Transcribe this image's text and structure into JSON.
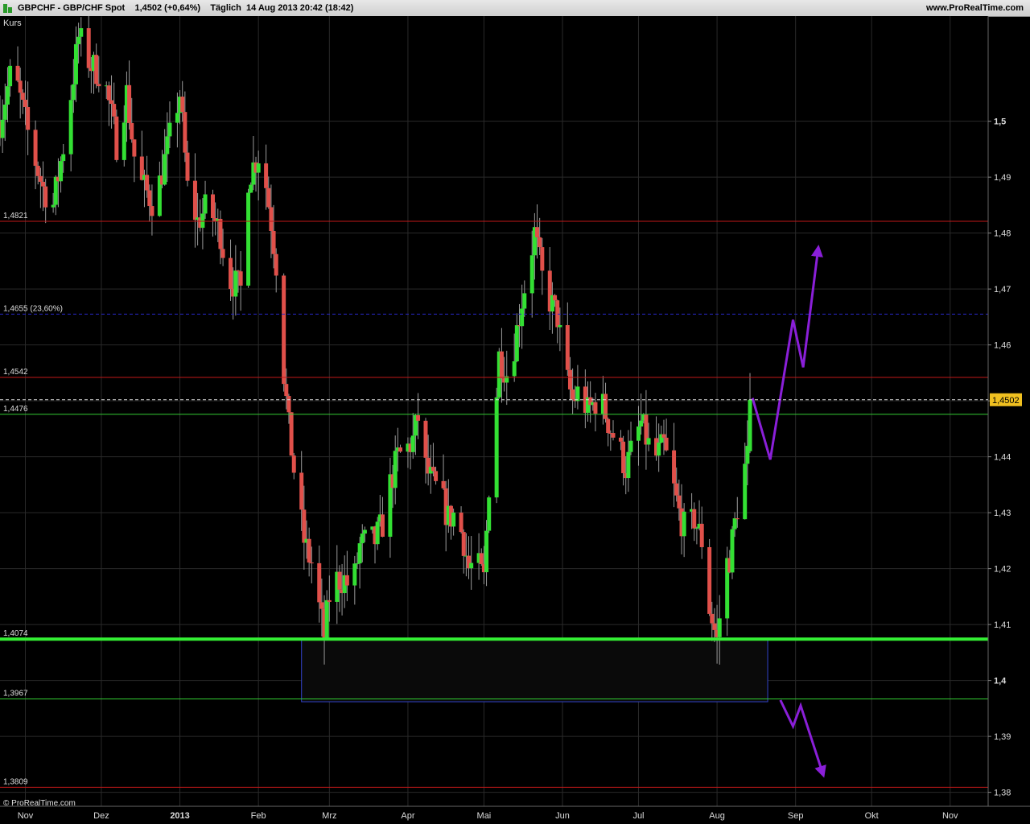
{
  "header": {
    "symbol": "GBPCHF - GBP/CHF Spot",
    "price_change": "1,4502 (+0,64%)",
    "info": "Täglich  14 Aug 2013 20:42 (18:42)",
    "site": "www.ProRealTime.com"
  },
  "watermark": "© ProRealTime.com",
  "colors": {
    "up": "#33e033",
    "down": "#e0504a",
    "background": "#000000",
    "grid": "#2a2a2a",
    "arrows": "#8a1fd8",
    "price_tag": "#f0c020"
  },
  "chart_data": {
    "type": "candlestick",
    "title": "",
    "ylabel": "Kurs",
    "xlabel": "",
    "ylim": [
      1.3775,
      1.5188
    ],
    "y_ticks": [
      "1,5",
      "1,49",
      "1,48",
      "1,47",
      "1,46",
      "1,45",
      "1,44",
      "1,43",
      "1,42",
      "1,41",
      "1,4",
      "1,39",
      "1,38"
    ],
    "y_tick_values": [
      1.5,
      1.49,
      1.48,
      1.47,
      1.46,
      1.45,
      1.44,
      1.43,
      1.42,
      1.41,
      1.4,
      1.39,
      1.38
    ],
    "x_ticks": [
      "Nov",
      "Dez",
      "2013",
      "Feb",
      "Mrz",
      "Apr",
      "Mai",
      "Jun",
      "Jul",
      "Aug",
      "Sep",
      "Okt",
      "Nov"
    ],
    "x_tick_dates": [
      "2012-11-01",
      "2012-12-01",
      "2013-01-01",
      "2013-02-01",
      "2013-03-01",
      "2013-04-01",
      "2013-05-01",
      "2013-06-01",
      "2013-07-01",
      "2013-08-01",
      "2013-09-01",
      "2013-10-01",
      "2013-11-01"
    ],
    "x_tick_bold": [
      false,
      false,
      true,
      false,
      false,
      false,
      false,
      false,
      false,
      false,
      false,
      false,
      false
    ],
    "current_price": {
      "value": 1.4502,
      "label": "1,4502"
    },
    "levels": [
      {
        "value": 1.4821,
        "label": "1,4821",
        "color": "#c01818",
        "style": "solid",
        "width": 1
      },
      {
        "value": 1.4655,
        "label": "1,4655 (23,60%)",
        "color": "#2828c8",
        "style": "dashed",
        "width": 1
      },
      {
        "value": 1.4542,
        "label": "1,4542",
        "color": "#c01818",
        "style": "solid",
        "width": 1
      },
      {
        "value": 1.4476,
        "label": "1,4476",
        "color": "#33cc33",
        "style": "solid",
        "width": 1
      },
      {
        "value": 1.4074,
        "label": "1,4074",
        "color": "#33ee33",
        "style": "solid",
        "width": 4
      },
      {
        "value": 1.3967,
        "label": "1,3967",
        "color": "#33cc33",
        "style": "solid",
        "width": 1
      },
      {
        "value": 1.3809,
        "label": "1,3809",
        "color": "#c01818",
        "style": "solid",
        "width": 1
      }
    ],
    "zone": {
      "date_start": "2013-02-18",
      "date_end": "2013-08-21",
      "y_low": 1.3962,
      "y_high": 1.4074
    },
    "projections": {
      "up": [
        [
          "2013-08-15",
          1.4505
        ],
        [
          "2013-08-22",
          1.4395
        ],
        [
          "2013-08-31",
          1.4645
        ],
        [
          "2013-09-04",
          1.456
        ],
        [
          "2013-09-10",
          1.4775
        ]
      ],
      "down": [
        [
          "2013-08-26",
          1.3965
        ],
        [
          "2013-08-31",
          1.3918
        ],
        [
          "2013-09-03",
          1.3955
        ],
        [
          "2013-09-12",
          1.383
        ]
      ]
    },
    "closes": [
      [
        "2012-10-22",
        1.5
      ],
      [
        "2012-10-27",
        1.51
      ],
      [
        "2012-11-03",
        1.496
      ],
      [
        "2012-11-08",
        1.488
      ],
      [
        "2012-11-12",
        1.485
      ],
      [
        "2012-11-17",
        1.498
      ],
      [
        "2012-11-22",
        1.515
      ],
      [
        "2012-11-27",
        1.51
      ],
      [
        "2012-12-02",
        1.508
      ],
      [
        "2012-12-07",
        1.496
      ],
      [
        "2012-12-11",
        1.505
      ],
      [
        "2012-12-15",
        1.49
      ],
      [
        "2012-12-18",
        1.488
      ],
      [
        "2012-12-22",
        1.485
      ],
      [
        "2012-12-27",
        1.495
      ],
      [
        "2013-01-01",
        1.505
      ],
      [
        "2013-01-04",
        1.488
      ],
      [
        "2013-01-08",
        1.482
      ],
      [
        "2013-01-12",
        1.485
      ],
      [
        "2013-01-17",
        1.48
      ],
      [
        "2013-01-20",
        1.472
      ],
      [
        "2013-01-25",
        1.47
      ],
      [
        "2013-01-28",
        1.49
      ],
      [
        "2013-02-02",
        1.495
      ],
      [
        "2013-02-06",
        1.482
      ],
      [
        "2013-02-09",
        1.471
      ],
      [
        "2013-02-11",
        1.455
      ],
      [
        "2013-02-13",
        1.445
      ],
      [
        "2013-02-16",
        1.434
      ],
      [
        "2013-02-19",
        1.425
      ],
      [
        "2013-02-21",
        1.422
      ],
      [
        "2013-02-23",
        1.42
      ],
      [
        "2013-02-25",
        1.413
      ],
      [
        "2013-02-27",
        1.408
      ],
      [
        "2013-03-01",
        1.415
      ],
      [
        "2013-03-04",
        1.418
      ],
      [
        "2013-03-07",
        1.418
      ],
      [
        "2013-03-10",
        1.416
      ],
      [
        "2013-03-13",
        1.424
      ],
      [
        "2013-03-16",
        1.425
      ],
      [
        "2013-03-19",
        1.425
      ],
      [
        "2013-03-22",
        1.428
      ],
      [
        "2013-03-25",
        1.435
      ],
      [
        "2013-03-28",
        1.44
      ],
      [
        "2013-03-31",
        1.441
      ],
      [
        "2013-04-03",
        1.443
      ],
      [
        "2013-04-05",
        1.447
      ],
      [
        "2013-04-08",
        1.438
      ],
      [
        "2013-04-11",
        1.435
      ],
      [
        "2013-04-14",
        1.433
      ],
      [
        "2013-04-17",
        1.429
      ],
      [
        "2013-04-20",
        1.43
      ],
      [
        "2013-04-23",
        1.425
      ],
      [
        "2013-04-25",
        1.42
      ],
      [
        "2013-04-28",
        1.421
      ],
      [
        "2013-05-01",
        1.418
      ],
      [
        "2013-05-03",
        1.435
      ],
      [
        "2013-05-05",
        1.445
      ],
      [
        "2013-05-07",
        1.458
      ],
      [
        "2013-05-10",
        1.455
      ],
      [
        "2013-05-13",
        1.46
      ],
      [
        "2013-05-16",
        1.468
      ],
      [
        "2013-05-19",
        1.475
      ],
      [
        "2013-05-21",
        1.48
      ],
      [
        "2013-05-24",
        1.472
      ],
      [
        "2013-05-27",
        1.468
      ],
      [
        "2013-05-30",
        1.465
      ],
      [
        "2013-06-02",
        1.455
      ],
      [
        "2013-06-05",
        1.45
      ],
      [
        "2013-06-08",
        1.452
      ],
      [
        "2013-06-11",
        1.448
      ],
      [
        "2013-06-14",
        1.45
      ],
      [
        "2013-06-17",
        1.449
      ],
      [
        "2013-06-20",
        1.445
      ],
      [
        "2013-06-23",
        1.442
      ],
      [
        "2013-06-26",
        1.438
      ],
      [
        "2013-06-29",
        1.442
      ],
      [
        "2013-07-02",
        1.446
      ],
      [
        "2013-07-05",
        1.442
      ],
      [
        "2013-07-08",
        1.44
      ],
      [
        "2013-07-11",
        1.442
      ],
      [
        "2013-07-14",
        1.436
      ],
      [
        "2013-07-17",
        1.43
      ],
      [
        "2013-07-20",
        1.426
      ],
      [
        "2013-07-23",
        1.429
      ],
      [
        "2013-07-26",
        1.425
      ],
      [
        "2013-07-29",
        1.413
      ],
      [
        "2013-08-01",
        1.407
      ],
      [
        "2013-08-04",
        1.42
      ],
      [
        "2013-08-06",
        1.422
      ],
      [
        "2013-08-08",
        1.428
      ],
      [
        "2013-08-10",
        1.434
      ],
      [
        "2013-08-13",
        1.44
      ],
      [
        "2013-08-14",
        1.4502
      ]
    ]
  }
}
